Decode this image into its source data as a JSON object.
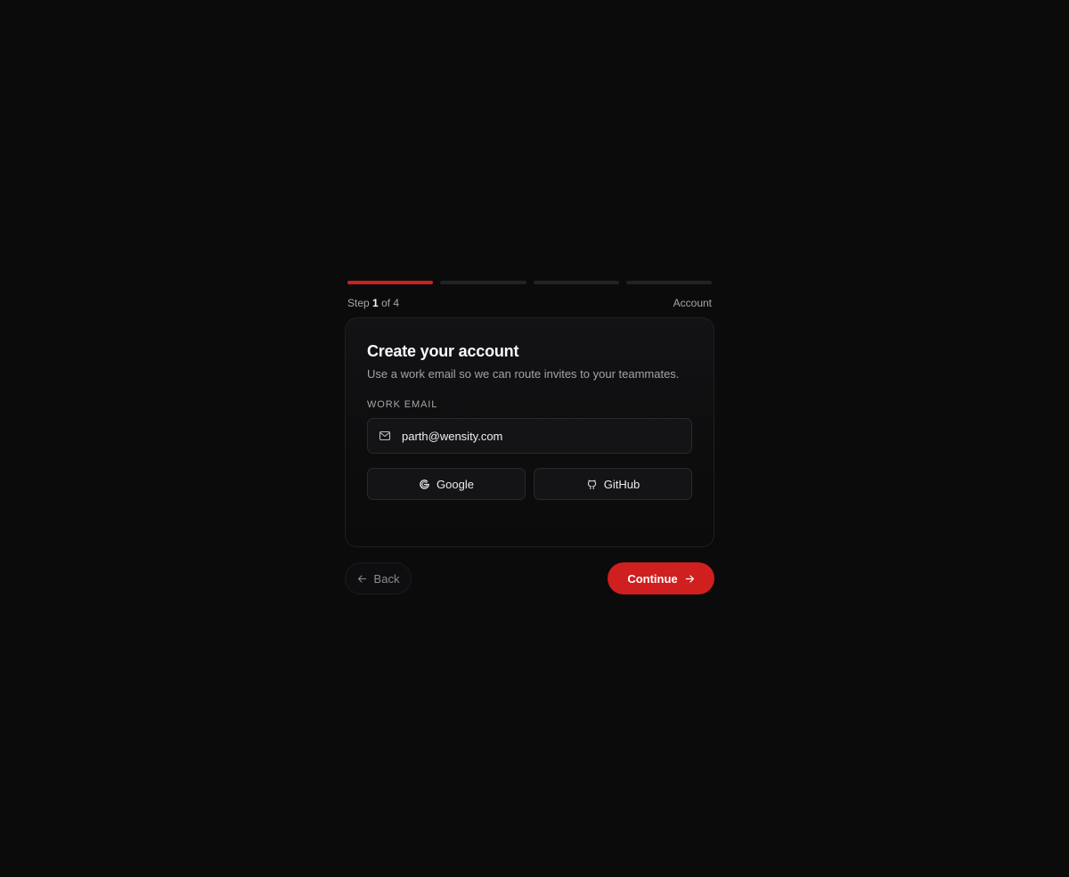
{
  "progress": {
    "total_steps": 4,
    "current_step": 1,
    "step_prefix": "Step",
    "step_number": "1",
    "step_suffix": "of 4",
    "step_name": "Account"
  },
  "card": {
    "title": "Create your account",
    "subtitle": "Use a work email so we can route invites to your teammates.",
    "email_label": "WORK EMAIL",
    "email_value": "parth@wensity.com",
    "email_icon": "mail-icon"
  },
  "oauth": {
    "google_label": "Google",
    "google_icon": "google-icon",
    "github_label": "GitHub",
    "github_icon": "github-icon"
  },
  "footer": {
    "back_label": "Back",
    "continue_label": "Continue"
  },
  "colors": {
    "background": "#0b0b0b",
    "accent": "#d01f1f",
    "inactive_segment": "#232325"
  }
}
